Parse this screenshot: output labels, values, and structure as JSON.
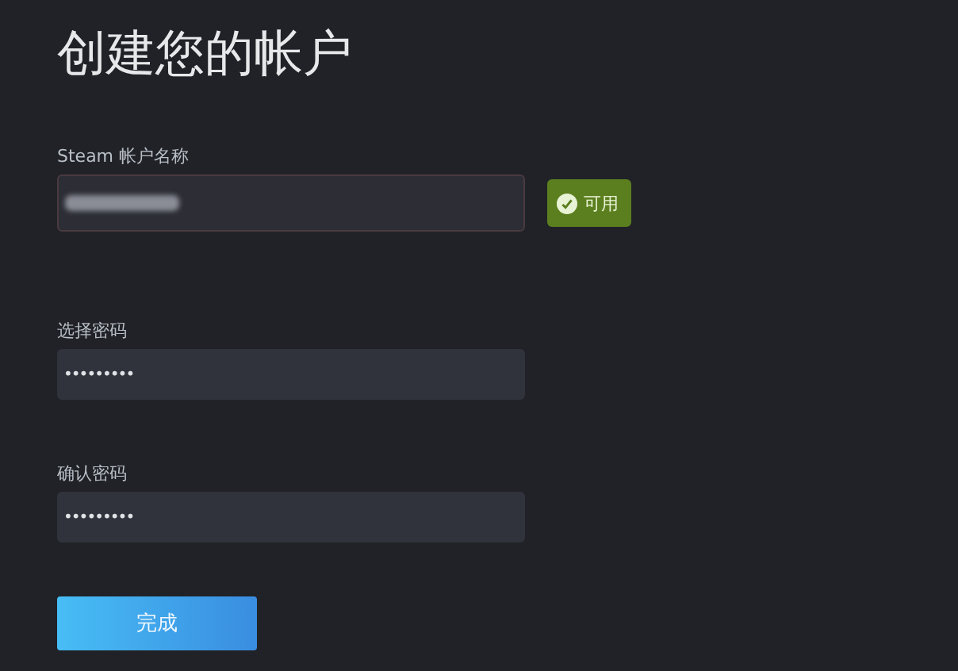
{
  "title": "创建您的帐户",
  "fields": [
    {
      "label": "Steam 帐户名称",
      "kind": "username",
      "value_hidden": true,
      "status": {
        "label": "可用",
        "available": true
      }
    },
    {
      "label": "选择密码",
      "kind": "password",
      "value": "•••••••••"
    },
    {
      "label": "确认密码",
      "kind": "password",
      "value": "•••••••••"
    }
  ],
  "submit": "完成"
}
